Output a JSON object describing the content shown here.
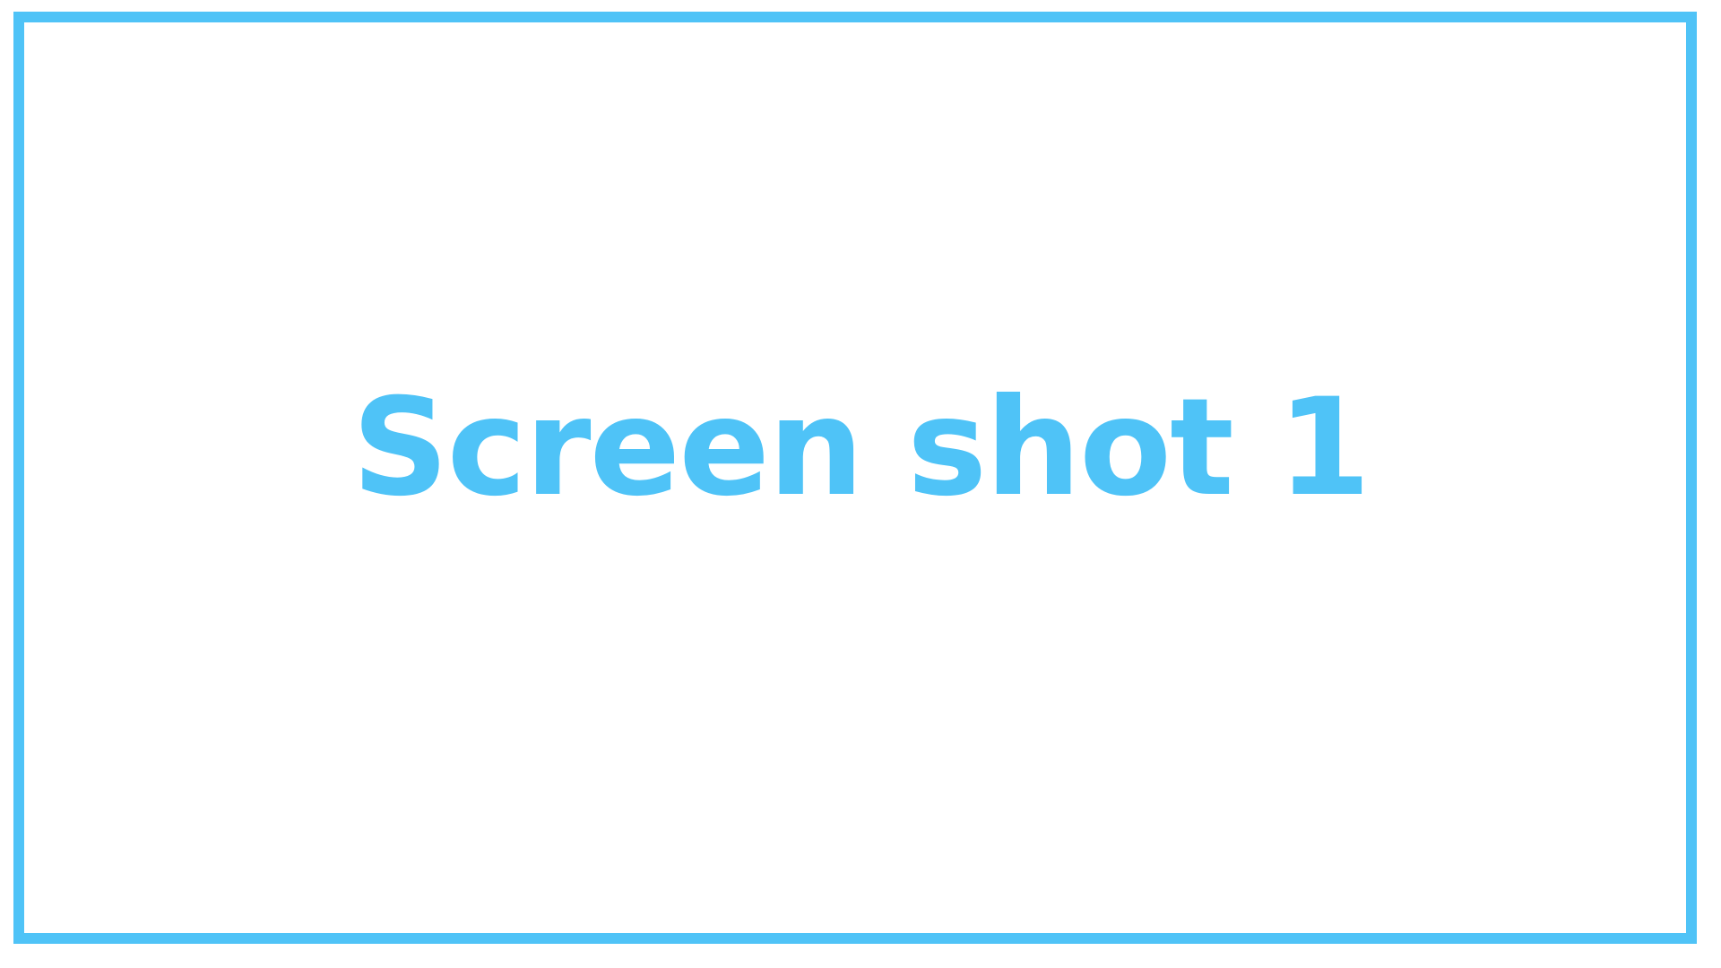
{
  "placeholder": {
    "text": "Screen shot 1",
    "color": "#4FC3F7",
    "border_color": "#4FC3F7",
    "background_color": "#FFFFFF"
  }
}
